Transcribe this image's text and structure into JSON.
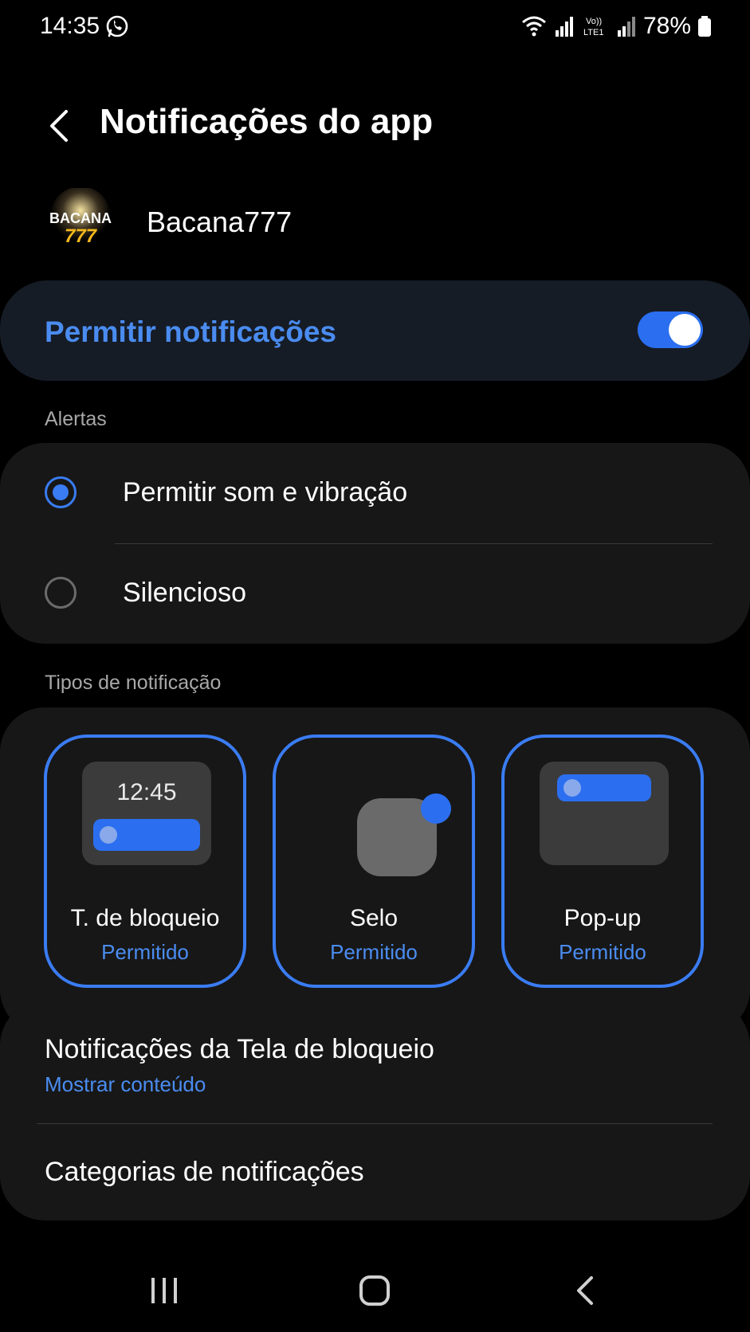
{
  "status_bar": {
    "time": "14:35",
    "battery": "78%",
    "icons": [
      "whatsapp-icon",
      "wifi-icon",
      "signal-icon",
      "volte-icon",
      "signal-icon",
      "battery-icon"
    ],
    "volte_line1": "Vo))",
    "volte_line2": "LTE1"
  },
  "header": {
    "title": "Notificações do app",
    "back_icon": "chevron-left-icon"
  },
  "app": {
    "name": "Bacana777",
    "logo_line1": "BACANA",
    "logo_line2": "777"
  },
  "allow": {
    "label": "Permitir notificações",
    "enabled": true
  },
  "alerts": {
    "section_label": "Alertas",
    "options": [
      {
        "label": "Permitir som e vibração",
        "selected": true
      },
      {
        "label": "Silencioso",
        "selected": false
      }
    ]
  },
  "notification_types": {
    "section_label": "Tipos de notificação",
    "items": [
      {
        "name": "T. de bloqueio",
        "status": "Permitido",
        "preview_time": "12:45"
      },
      {
        "name": "Selo",
        "status": "Permitido"
      },
      {
        "name": "Pop-up",
        "status": "Permitido"
      }
    ]
  },
  "lock_screen": {
    "title": "Notificações da Tela de bloqueio",
    "value": "Mostrar conteúdo"
  },
  "categories": {
    "title": "Categorias de notificações"
  },
  "colors": {
    "accent": "#3a7cf2",
    "accent_text": "#4a8cf0",
    "card": "#171717",
    "allow_card": "#161c26",
    "background": "#000000"
  },
  "navbar": {
    "icons": [
      "recents-icon",
      "home-icon",
      "back-icon"
    ]
  }
}
